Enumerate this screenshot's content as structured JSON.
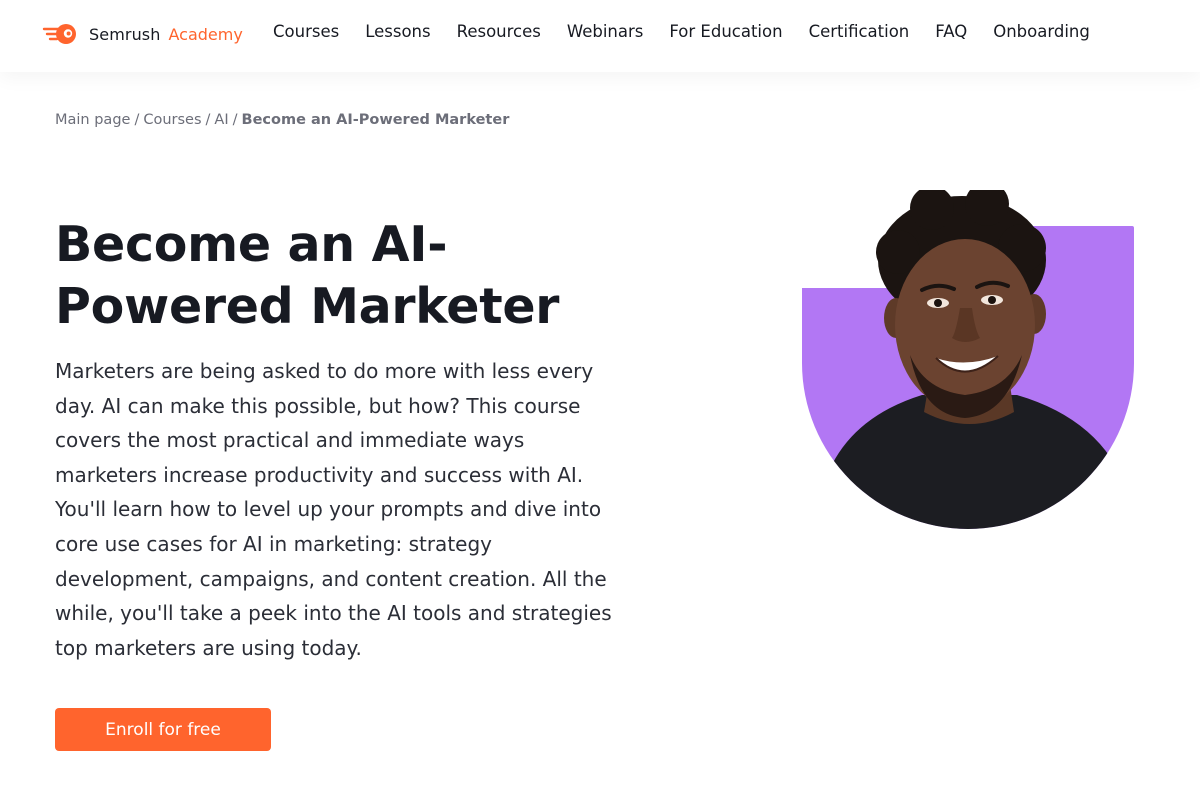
{
  "header": {
    "brand": "Semrush",
    "brand_suffix": "Academy",
    "logo_icon": "semrush-fire-icon",
    "nav": [
      "Courses",
      "Lessons",
      "Resources",
      "Webinars",
      "For Education",
      "Certification",
      "FAQ",
      "Onboarding"
    ]
  },
  "breadcrumb": {
    "items": [
      "Main page",
      "Courses",
      "AI"
    ],
    "current": "Become an AI-Powered Marketer"
  },
  "hero": {
    "title": "Become an AI-Powered Marketer",
    "description": "Marketers are being asked to do more with less every day. AI can make this possible, but how? This course covers the most practical and immediate ways marketers increase productivity and success with AI. You'll learn how to level up your prompts and dive into core use cases for AI in marketing: strategy development, campaigns, and content creation. All the while, you'll take a peek into the AI tools and strategies top marketers are using today.",
    "cta": "Enroll for free",
    "image": "instructor-portrait"
  },
  "colors": {
    "accent": "#ff642d",
    "purple": "#b277f4",
    "text": "#171a22",
    "muted": "#6c6e79"
  }
}
